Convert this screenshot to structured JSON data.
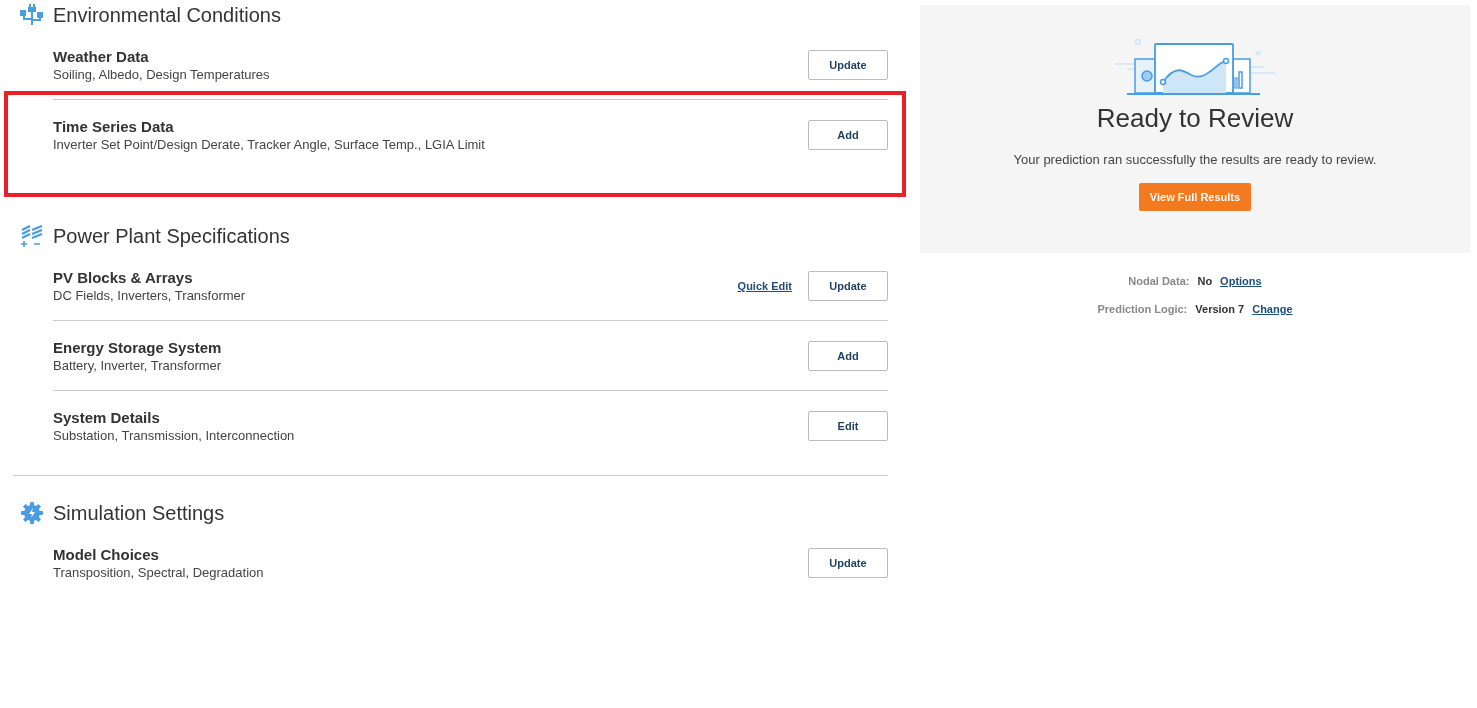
{
  "sections": [
    {
      "title": "Environmental Conditions",
      "items": [
        {
          "title": "Weather Data",
          "subtitle": "Soiling, Albedo, Design Temperatures",
          "button": "Update",
          "highlighted": false
        },
        {
          "title": "Time Series Data",
          "subtitle": "Inverter Set Point/Design Derate, Tracker Angle, Surface Temp., LGIA Limit",
          "button": "Add",
          "highlighted": true
        }
      ]
    },
    {
      "title": "Power Plant Specifications",
      "items": [
        {
          "title": "PV Blocks & Arrays",
          "subtitle": "DC Fields, Inverters, Transformer",
          "link": "Quick Edit",
          "button": "Update",
          "highlighted": false
        },
        {
          "title": "Energy Storage System",
          "subtitle": "Battery, Inverter, Transformer",
          "button": "Add",
          "highlighted": false
        },
        {
          "title": "System Details",
          "subtitle": "Substation, Transmission, Interconnection",
          "button": "Edit",
          "highlighted": false
        }
      ]
    },
    {
      "title": "Simulation Settings",
      "items": [
        {
          "title": "Model Choices",
          "subtitle": "Transposition, Spectral, Degradation",
          "button": "Update",
          "highlighted": false
        }
      ]
    }
  ],
  "review": {
    "title": "Ready to Review",
    "message": "Your prediction ran successfully the results are ready to review.",
    "button": "View Full Results"
  },
  "details": [
    {
      "label": "Nodal Data:",
      "value": "No",
      "link": "Options"
    },
    {
      "label": "Prediction Logic:",
      "value": "Version 7",
      "link": "Change"
    }
  ]
}
